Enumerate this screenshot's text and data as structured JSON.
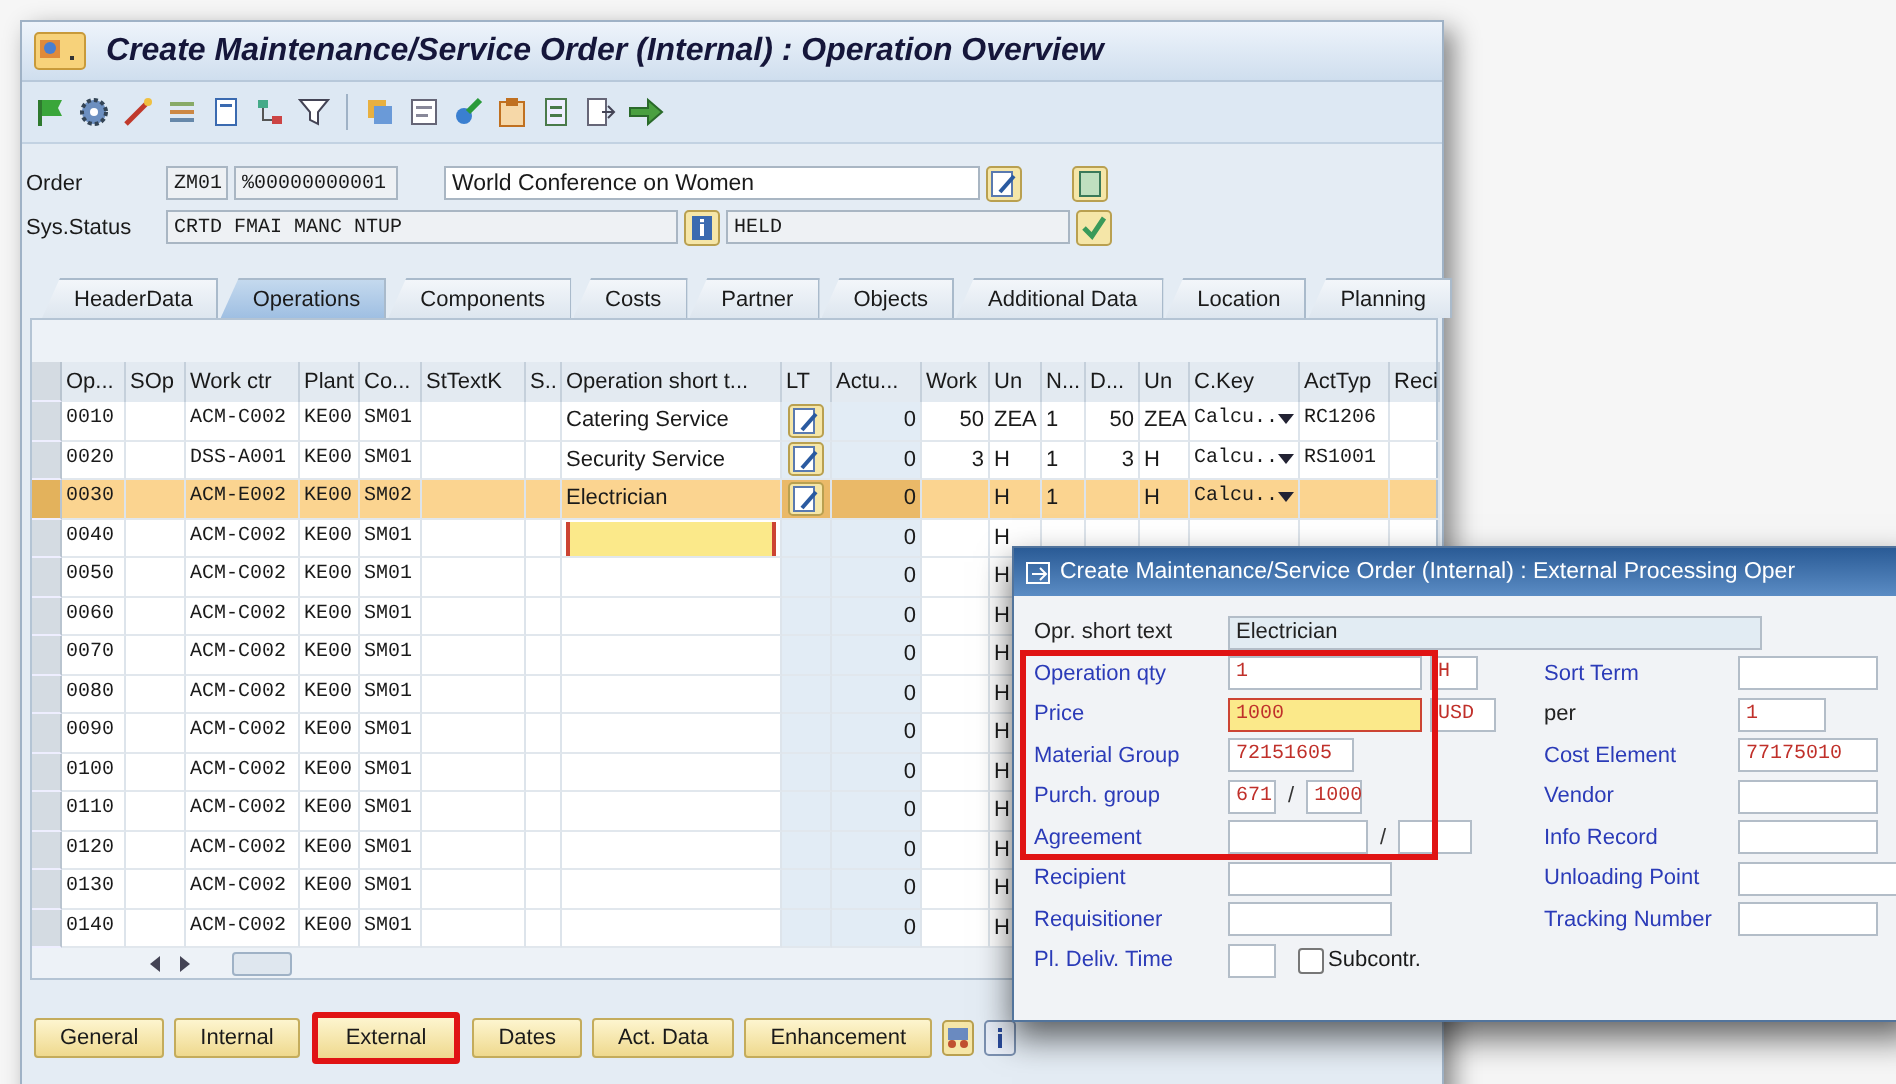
{
  "window": {
    "title": "Create Maintenance/Service Order (Internal) : Operation Overview"
  },
  "header": {
    "order_label": "Order",
    "order_type": "ZM01",
    "order_number": "%00000000001",
    "description": "World Conference on Women",
    "status_label": "Sys.Status",
    "system_status": "CRTD FMAI MANC NTUP",
    "user_status": "HELD"
  },
  "tabs": [
    {
      "label": "HeaderData",
      "selected": false
    },
    {
      "label": "Operations",
      "selected": true
    },
    {
      "label": "Components",
      "selected": false
    },
    {
      "label": "Costs",
      "selected": false
    },
    {
      "label": "Partner",
      "selected": false
    },
    {
      "label": "Objects",
      "selected": false
    },
    {
      "label": "Additional Data",
      "selected": false
    },
    {
      "label": "Location",
      "selected": false
    },
    {
      "label": "Planning",
      "selected": false
    }
  ],
  "table": {
    "columns": [
      "Op...",
      "SOp",
      "Work ctr",
      "Plant",
      "Co...",
      "StTextK",
      "S..",
      "Operation short t...",
      "LT",
      "Actu...",
      "Work",
      "Un",
      "N...",
      "D...",
      "Un",
      "C.Key",
      "ActTyp",
      "Reci"
    ],
    "rows": [
      {
        "op": "0010",
        "work_ctr": "ACM-C002",
        "plant": "KE00",
        "control_key": "SM01",
        "short_text": "Catering Service",
        "long_text": true,
        "actual": "0",
        "work": "50",
        "unit": "ZEA",
        "number": "1",
        "duration": "50",
        "duration_unit": "ZEA",
        "calc_key": "Calcu..",
        "activity_type": "RC1206",
        "selected": false,
        "editing": false
      },
      {
        "op": "0020",
        "work_ctr": "DSS-A001",
        "plant": "KE00",
        "control_key": "SM01",
        "short_text": "Security Service",
        "long_text": true,
        "actual": "0",
        "work": "3",
        "unit": "H",
        "number": "1",
        "duration": "3",
        "duration_unit": "H",
        "calc_key": "Calcu..",
        "activity_type": "RS1001",
        "selected": false,
        "editing": false
      },
      {
        "op": "0030",
        "work_ctr": "ACM-E002",
        "plant": "KE00",
        "control_key": "SM02",
        "short_text": "Electrician",
        "long_text": true,
        "actual": "0",
        "unit": "H",
        "number": "1",
        "duration_unit": "H",
        "calc_key": "Calcu..",
        "selected": true,
        "editing": false
      },
      {
        "op": "0040",
        "work_ctr": "ACM-C002",
        "plant": "KE00",
        "control_key": "SM01",
        "long_text": false,
        "actual": "0",
        "unit": "H",
        "selected": false,
        "editing": true
      },
      {
        "op": "0050",
        "work_ctr": "ACM-C002",
        "plant": "KE00",
        "control_key": "SM01",
        "long_text": false,
        "actual": "0",
        "unit": "H",
        "selected": false,
        "editing": false
      },
      {
        "op": "0060",
        "work_ctr": "ACM-C002",
        "plant": "KE00",
        "control_key": "SM01",
        "long_text": false,
        "actual": "0",
        "unit": "H",
        "selected": false,
        "editing": false
      },
      {
        "op": "0070",
        "work_ctr": "ACM-C002",
        "plant": "KE00",
        "control_key": "SM01",
        "long_text": false,
        "actual": "0",
        "unit": "H",
        "selected": false,
        "editing": false
      },
      {
        "op": "0080",
        "work_ctr": "ACM-C002",
        "plant": "KE00",
        "control_key": "SM01",
        "long_text": false,
        "actual": "0",
        "unit": "H",
        "selected": false,
        "editing": false
      },
      {
        "op": "0090",
        "work_ctr": "ACM-C002",
        "plant": "KE00",
        "control_key": "SM01",
        "long_text": false,
        "actual": "0",
        "unit": "H",
        "selected": false,
        "editing": false
      },
      {
        "op": "0100",
        "work_ctr": "ACM-C002",
        "plant": "KE00",
        "control_key": "SM01",
        "long_text": false,
        "actual": "0",
        "unit": "H",
        "selected": false,
        "editing": false
      },
      {
        "op": "0110",
        "work_ctr": "ACM-C002",
        "plant": "KE00",
        "control_key": "SM01",
        "long_text": false,
        "actual": "0",
        "unit": "H",
        "selected": false,
        "editing": false
      },
      {
        "op": "0120",
        "work_ctr": "ACM-C002",
        "plant": "KE00",
        "control_key": "SM01",
        "long_text": false,
        "actual": "0",
        "unit": "H",
        "selected": false,
        "editing": false
      },
      {
        "op": "0130",
        "work_ctr": "ACM-C002",
        "plant": "KE00",
        "control_key": "SM01",
        "long_text": false,
        "actual": "0",
        "unit": "H",
        "selected": false,
        "editing": false
      },
      {
        "op": "0140",
        "work_ctr": "ACM-C002",
        "plant": "KE00",
        "control_key": "SM01",
        "long_text": false,
        "actual": "0",
        "unit": "H",
        "selected": false,
        "editing": false
      }
    ]
  },
  "bottom_buttons": [
    {
      "label": "General",
      "highlighted": false
    },
    {
      "label": "Internal",
      "highlighted": false
    },
    {
      "label": "External",
      "highlighted": true
    },
    {
      "label": "Dates",
      "highlighted": false
    },
    {
      "label": "Act. Data",
      "highlighted": false
    },
    {
      "label": "Enhancement",
      "highlighted": false
    }
  ],
  "dialog": {
    "title": "Create Maintenance/Service Order (Internal) : External Processing Oper",
    "short_text_label": "Opr. short text",
    "short_text": "Electrician",
    "annotation_frame": true,
    "left_fields": [
      {
        "label": "Operation qty",
        "kind": "link",
        "inputs": [
          {
            "value": "1",
            "focused": false
          },
          {
            "value": "H",
            "focused": false
          }
        ]
      },
      {
        "label": "Price",
        "kind": "link",
        "inputs": [
          {
            "value": "1000",
            "focused": true
          },
          {
            "value": "USD",
            "focused": false
          }
        ]
      },
      {
        "label": "Material Group",
        "kind": "link",
        "inputs": [
          {
            "value": "72151605",
            "focused": false
          }
        ]
      },
      {
        "label": "Purch. group",
        "kind": "link",
        "separator": "/",
        "inputs": [
          {
            "value": "671",
            "focused": false
          },
          {
            "value": "1000",
            "focused": false
          }
        ]
      },
      {
        "label": "Agreement",
        "kind": "link",
        "separator": "/",
        "inputs": [
          {
            "focused": false
          },
          {
            "focused": false
          }
        ]
      },
      {
        "label": "Recipient",
        "kind": "link",
        "inputs": [
          {
            "focused": false
          }
        ]
      },
      {
        "label": "Requisitioner",
        "kind": "link",
        "inputs": [
          {
            "focused": false
          }
        ]
      },
      {
        "label": "Pl. Deliv. Time",
        "kind": "link",
        "inputs": [
          {
            "focused": false
          }
        ],
        "checkbox": {
          "label": "Subcontr.",
          "checked": false
        }
      }
    ],
    "right_fields": [
      {
        "label": "Sort Term",
        "kind": "link",
        "inputs": [
          {
            "focused": false
          }
        ]
      },
      {
        "label": "per",
        "kind": "plain",
        "inputs": [
          {
            "value": "1",
            "focused": false
          }
        ]
      },
      {
        "label": "Cost Element",
        "kind": "link",
        "inputs": [
          {
            "value": "77175010",
            "focused": false
          }
        ]
      },
      {
        "label": "Vendor",
        "kind": "link",
        "inputs": [
          {
            "focused": false
          }
        ]
      },
      {
        "label": "Info Record",
        "kind": "link",
        "inputs": [
          {
            "focused": false
          }
        ]
      },
      {
        "label": "Unloading Point",
        "kind": "link",
        "inputs": [
          {
            "focused": false
          }
        ]
      },
      {
        "label": "Tracking Number",
        "kind": "link",
        "inputs": [
          {
            "focused": false
          }
        ]
      }
    ]
  }
}
